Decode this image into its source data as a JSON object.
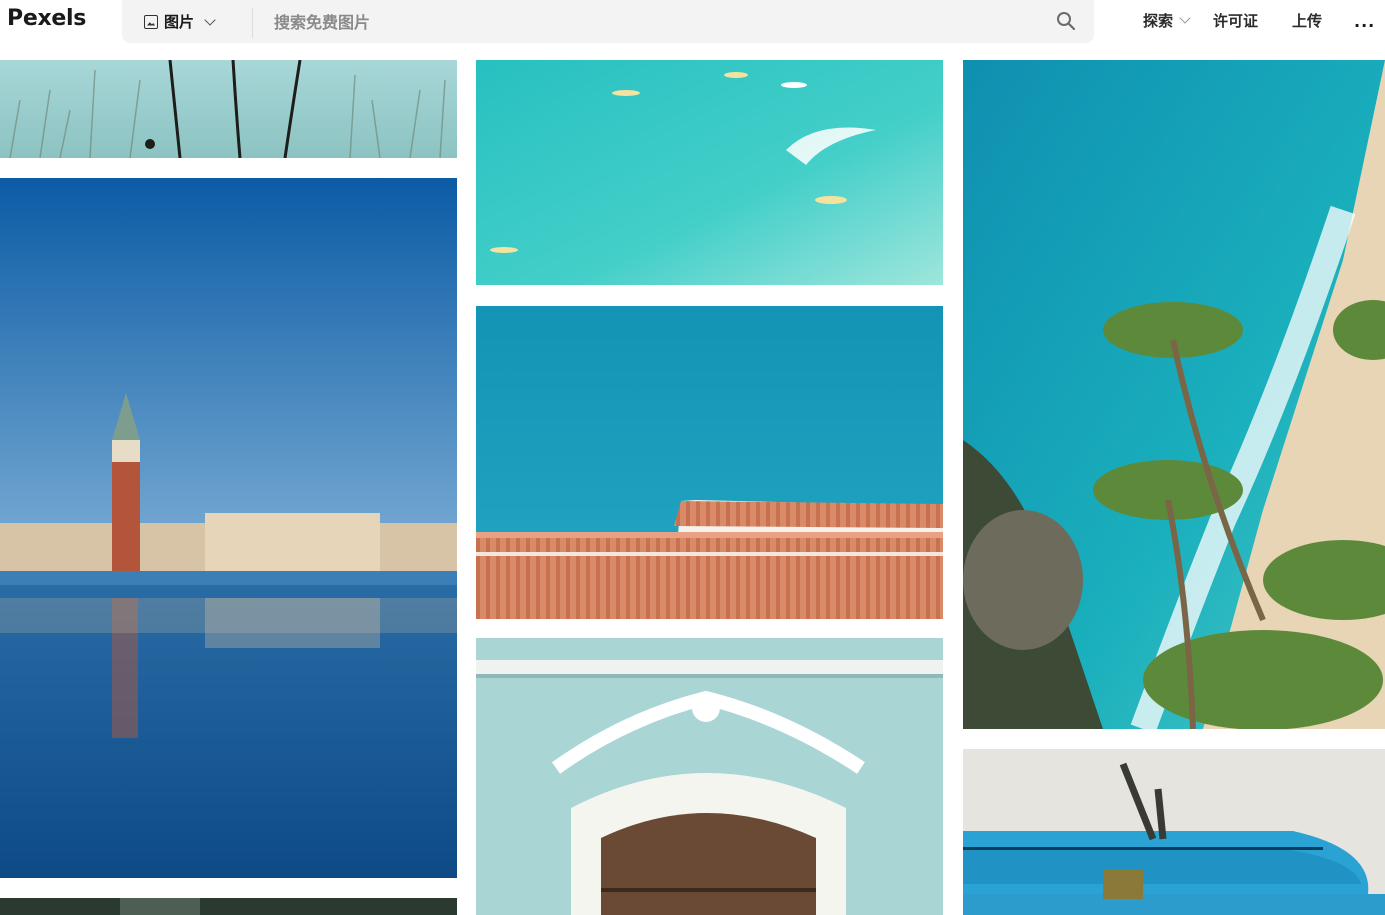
{
  "header": {
    "logo": "Pexels",
    "type_selector": {
      "label": "图片",
      "icon": "image-icon"
    },
    "search": {
      "placeholder": "搜索免费图片",
      "icon": "search-icon"
    },
    "nav": {
      "explore": "探索",
      "license": "许可证",
      "upload": "上传",
      "more": "···"
    }
  },
  "gallery": {
    "photos": [
      {
        "id": "grass-sky",
        "colors": [
          "#9fd0d3",
          "#2b2b25"
        ]
      },
      {
        "id": "venice-campanile",
        "colors": [
          "#0e5fa8",
          "#1a4f8a"
        ]
      },
      {
        "id": "dark-bottom-left",
        "colors": [
          "#203028"
        ]
      },
      {
        "id": "aerial-surfers",
        "colors": [
          "#2fc6c4",
          "#7fe0d8"
        ]
      },
      {
        "id": "terracotta-roof",
        "colors": [
          "#0f97b8",
          "#d98a6a"
        ]
      },
      {
        "id": "mint-window",
        "colors": [
          "#a9d6d6",
          "#6a4a35"
        ]
      },
      {
        "id": "beach-palms",
        "colors": [
          "#0fa8b8",
          "#e6d2b0"
        ]
      },
      {
        "id": "surfboards",
        "colors": [
          "#e6e4df",
          "#2a9fd0"
        ]
      }
    ]
  }
}
